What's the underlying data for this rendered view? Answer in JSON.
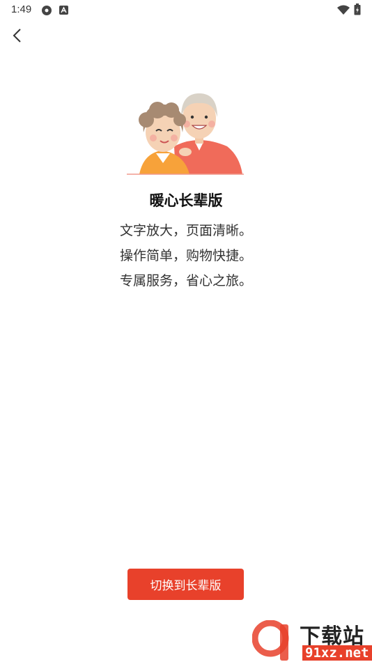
{
  "status_bar": {
    "time": "1:49"
  },
  "main": {
    "title": "暖心长辈版",
    "lines": [
      "文字放大，页面清晰。",
      "操作简单，购物快捷。",
      "专属服务，省心之旅。"
    ]
  },
  "switch_button_label": "切换到长辈版",
  "watermark": {
    "big": "下载站",
    "small": "91xz.net"
  },
  "colors": {
    "accent": "#e8412b"
  }
}
